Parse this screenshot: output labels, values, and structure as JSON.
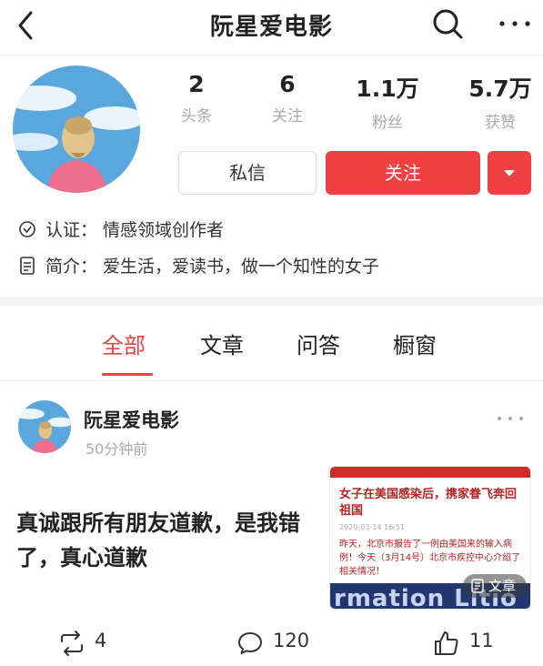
{
  "header": {
    "title": "阮星爱电影"
  },
  "profile": {
    "stats": [
      {
        "value": "2",
        "label": "头条"
      },
      {
        "value": "6",
        "label": "关注"
      },
      {
        "value": "1.1万",
        "label": "粉丝"
      },
      {
        "value": "5.7万",
        "label": "获赞"
      }
    ],
    "message_label": "私信",
    "follow_label": "关注",
    "verification": "认证：  情感领域创作者",
    "bio": "简介：  爱生活，爱读书，做一个知性的女子"
  },
  "tabs": [
    {
      "label": "全部",
      "active": true
    },
    {
      "label": "文章",
      "active": false
    },
    {
      "label": "问答",
      "active": false
    },
    {
      "label": "橱窗",
      "active": false
    }
  ],
  "post": {
    "author": "阮星爱电影",
    "time": "50分钟前",
    "text": "真诚跟所有朋友道歉，是我错了，真心道歉",
    "thumbnail": {
      "headline": "女子在美国感染后，携家眷飞奔回祖国",
      "meta": "2020-03-14 16:51",
      "body": "昨天，北京市报告了一例由美国来的输入病例！今天（3月14号）北京市疾控中心介绍了相关情况！",
      "banner_text": "rmation Litio",
      "badge": "文章"
    },
    "reposts": "4",
    "comments": "120",
    "likes": "11"
  },
  "colors": {
    "accent": "#f04142",
    "muted": "#aaaaaa"
  }
}
